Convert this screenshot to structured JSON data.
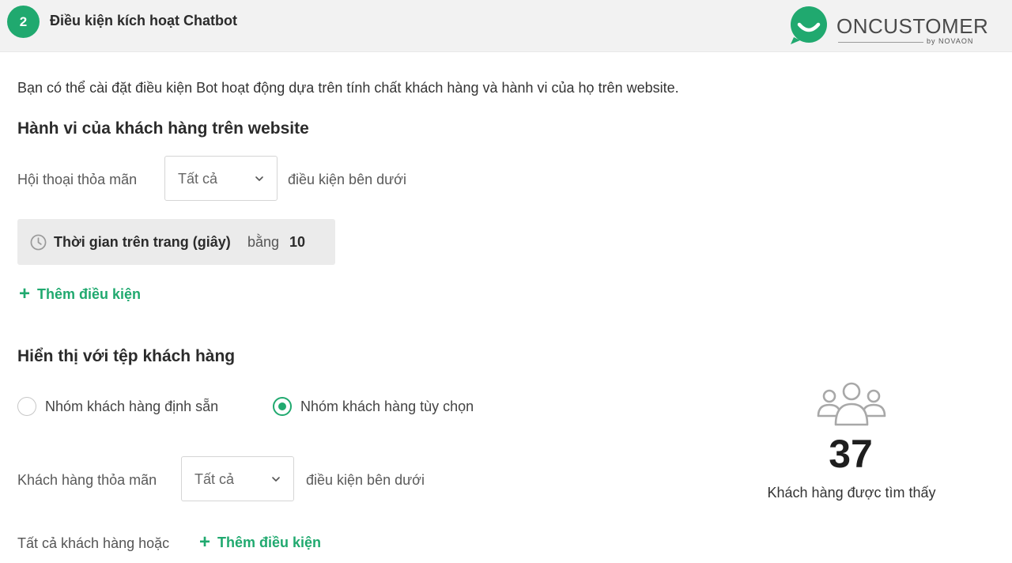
{
  "header": {
    "step_number": "2",
    "step_title": "Điều kiện kích hoạt Chatbot"
  },
  "logo": {
    "name": "ONCUSTOMER",
    "sub": "by NOVAON",
    "brand_color": "#20a96f"
  },
  "description": "Bạn có thể cài đặt điều kiện Bot hoạt động dựa trên tính chất khách hàng và hành vi của họ trên website.",
  "behavior": {
    "title": "Hành vi của khách hàng trên website",
    "match_label": "Hội thoại thỏa mãn",
    "match_value": "Tất cả",
    "match_suffix": "điều kiện bên dưới",
    "condition": {
      "icon": "clock-icon",
      "name": "Thời gian trên trang (giây)",
      "operator": "bằng",
      "value": "10"
    },
    "add_label": "Thêm điều kiện"
  },
  "audience": {
    "title": "Hiển thị với tệp khách hàng",
    "options": [
      {
        "label": "Nhóm khách hàng định sẵn",
        "selected": false
      },
      {
        "label": "Nhóm khách hàng tùy chọn",
        "selected": true
      }
    ],
    "match_label": "Khách hàng thỏa mãn",
    "match_value": "Tất cả",
    "match_suffix": "điều kiện bên dưới",
    "all_label": "Tất cả khách hàng hoặc",
    "add_label": "Thêm điều kiện"
  },
  "stats": {
    "icon": "users-icon",
    "count": "37",
    "label": "Khách hàng được tìm thấy"
  }
}
